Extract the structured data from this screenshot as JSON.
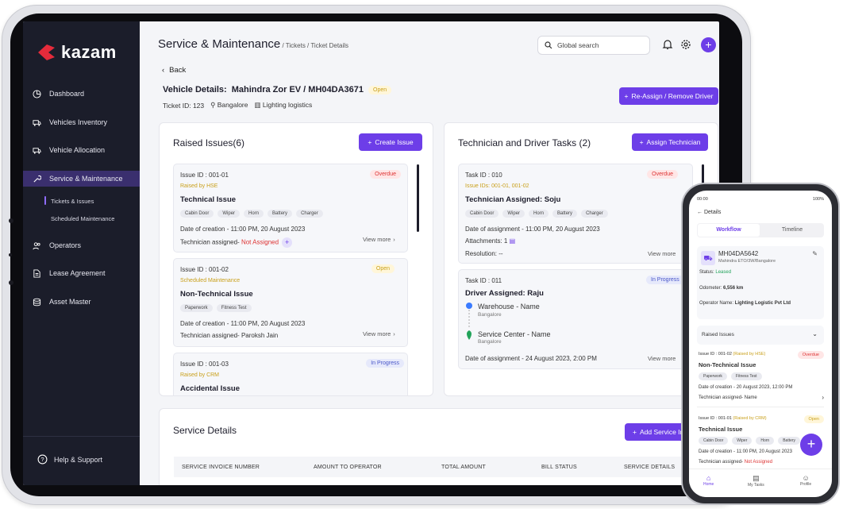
{
  "brand": {
    "name": "kazam"
  },
  "sidebar": {
    "items": [
      {
        "label": "Dashboard"
      },
      {
        "label": "Vehicles Inventory"
      },
      {
        "label": "Vehicle Allocation"
      },
      {
        "label": "Service & Maintenance"
      },
      {
        "label": "Operators"
      },
      {
        "label": "Lease Agreement"
      },
      {
        "label": "Asset Master"
      }
    ],
    "sub": [
      {
        "label": "Tickets & Issues"
      },
      {
        "label": "Scheduled Maintenance"
      }
    ],
    "help": "Help & Support"
  },
  "header": {
    "title": "Service & Maintenance",
    "breadcrumb": " / Tickets / Ticket Details",
    "search_placeholder": "Global search",
    "avatar": "+"
  },
  "page": {
    "back": "Back",
    "vehicle_label": "Vehicle Details:",
    "vehicle_value": "Mahindra Zor EV / MH04DA3671",
    "status": "Open",
    "ticket_id": "Ticket ID: 123",
    "location": "Bangalore",
    "company": "Lighting logistics",
    "reassign": "Re-Assign / Remove Driver"
  },
  "raised": {
    "title": "Raised Issues(6)",
    "create": "Create Issue",
    "issues": [
      {
        "id": "Issue ID : 001-01",
        "by": "Raised by HSE",
        "status": "Overdue",
        "title": "Technical Issue",
        "tags": [
          "Cabin Door",
          "Wiper",
          "Horn",
          "Battery",
          "Charger"
        ],
        "date": "Date of creation - 11:00 PM, 20 August 2023",
        "tech_label": "Technician assigned-",
        "tech_value": " Not Assigned",
        "view": "View more"
      },
      {
        "id": "Issue ID : 001-02",
        "by": "Scheduled Maintenance",
        "status": "Open",
        "title": "Non-Technical Issue",
        "tags": [
          "Paperwork",
          "Fitness Test"
        ],
        "date": "Date of creation - 11:00 PM, 20 August 2023",
        "tech_label": "Technician assigned-",
        "tech_value": " Paroksh Jain",
        "view": "View more"
      },
      {
        "id": "Issue ID : 001-03",
        "by": "Raised by CRM",
        "status": "In Progress",
        "title": "Accidental Issue"
      }
    ]
  },
  "tasks": {
    "title": "Technician and Driver Tasks (2)",
    "assign": "Assign Technician",
    "t1": {
      "id": "Task ID : 010",
      "ids": "Issue IDs: 001-01, 001-02",
      "status": "Overdue",
      "title": "Technician Assigned: Soju",
      "tags": [
        "Cabin Door",
        "Wiper",
        "Horn",
        "Battery",
        "Charger"
      ],
      "date": "Date of assignment - 11:00 PM, 20 August 2023",
      "attach": "Attachments: 1",
      "resolution": "Resolution: --",
      "view": "View more"
    },
    "t2": {
      "id": "Task ID : 011",
      "status": "In Progress",
      "title": "Driver Assigned: Raju",
      "from": "Warehouse - Name",
      "from_city": "Bangalore",
      "to": "Service Center -  Name",
      "to_city": "Bangalore",
      "date": "Date of assignment - 24 August 2023, 2:00 PM",
      "view": "View more"
    }
  },
  "service": {
    "title": "Service Details",
    "add": "Add Service In",
    "columns": [
      "SERVICE INVOICE NUMBER",
      "AMOUNT TO OPERATOR",
      "TOTAL AMOUNT",
      "BILL STATUS",
      "SERVICE DETAILS"
    ]
  },
  "phone": {
    "time": "00:00",
    "battery": "100%",
    "title": "Details",
    "tabs": [
      "Workflow",
      "Timeline"
    ],
    "vehicle": "MH04DA5642",
    "vehicle_sub": "Mahindra ETO/3W/Bangalore",
    "status_label": "Status:",
    "status_value": "Leased",
    "odo_label": "Odometer:",
    "odo_value": "6,556 km",
    "op_label": "Operator Name:",
    "op_value": "Lighting Logistic Pvt Ltd",
    "raised": "Raised Issues",
    "i1": {
      "id": "Issue ID : 001-02",
      "by": "(Raised by HSE)",
      "status": "Overdue",
      "title": "Non-Technical Issue",
      "tags": [
        "Paperwork",
        "Fitness Test"
      ],
      "date": "Date of creation - 20 August 2023, 12:00 PM",
      "tech": "Technician assigned- Name"
    },
    "i2": {
      "id": "Issue ID : 001-01",
      "by": "(Raised by CRM)",
      "status": "Open",
      "title": "Technical Issue",
      "tags": [
        "Cabin Door",
        "Wiper",
        "Horn",
        "Battery"
      ],
      "date": "Date of creation - 11:00 PM, 20 August 2023",
      "tech_label": "Technician assigned-",
      "tech_value": " Not Assigned"
    },
    "fab": "+",
    "nav": [
      "Home",
      "My Tasks",
      "Profile"
    ]
  }
}
